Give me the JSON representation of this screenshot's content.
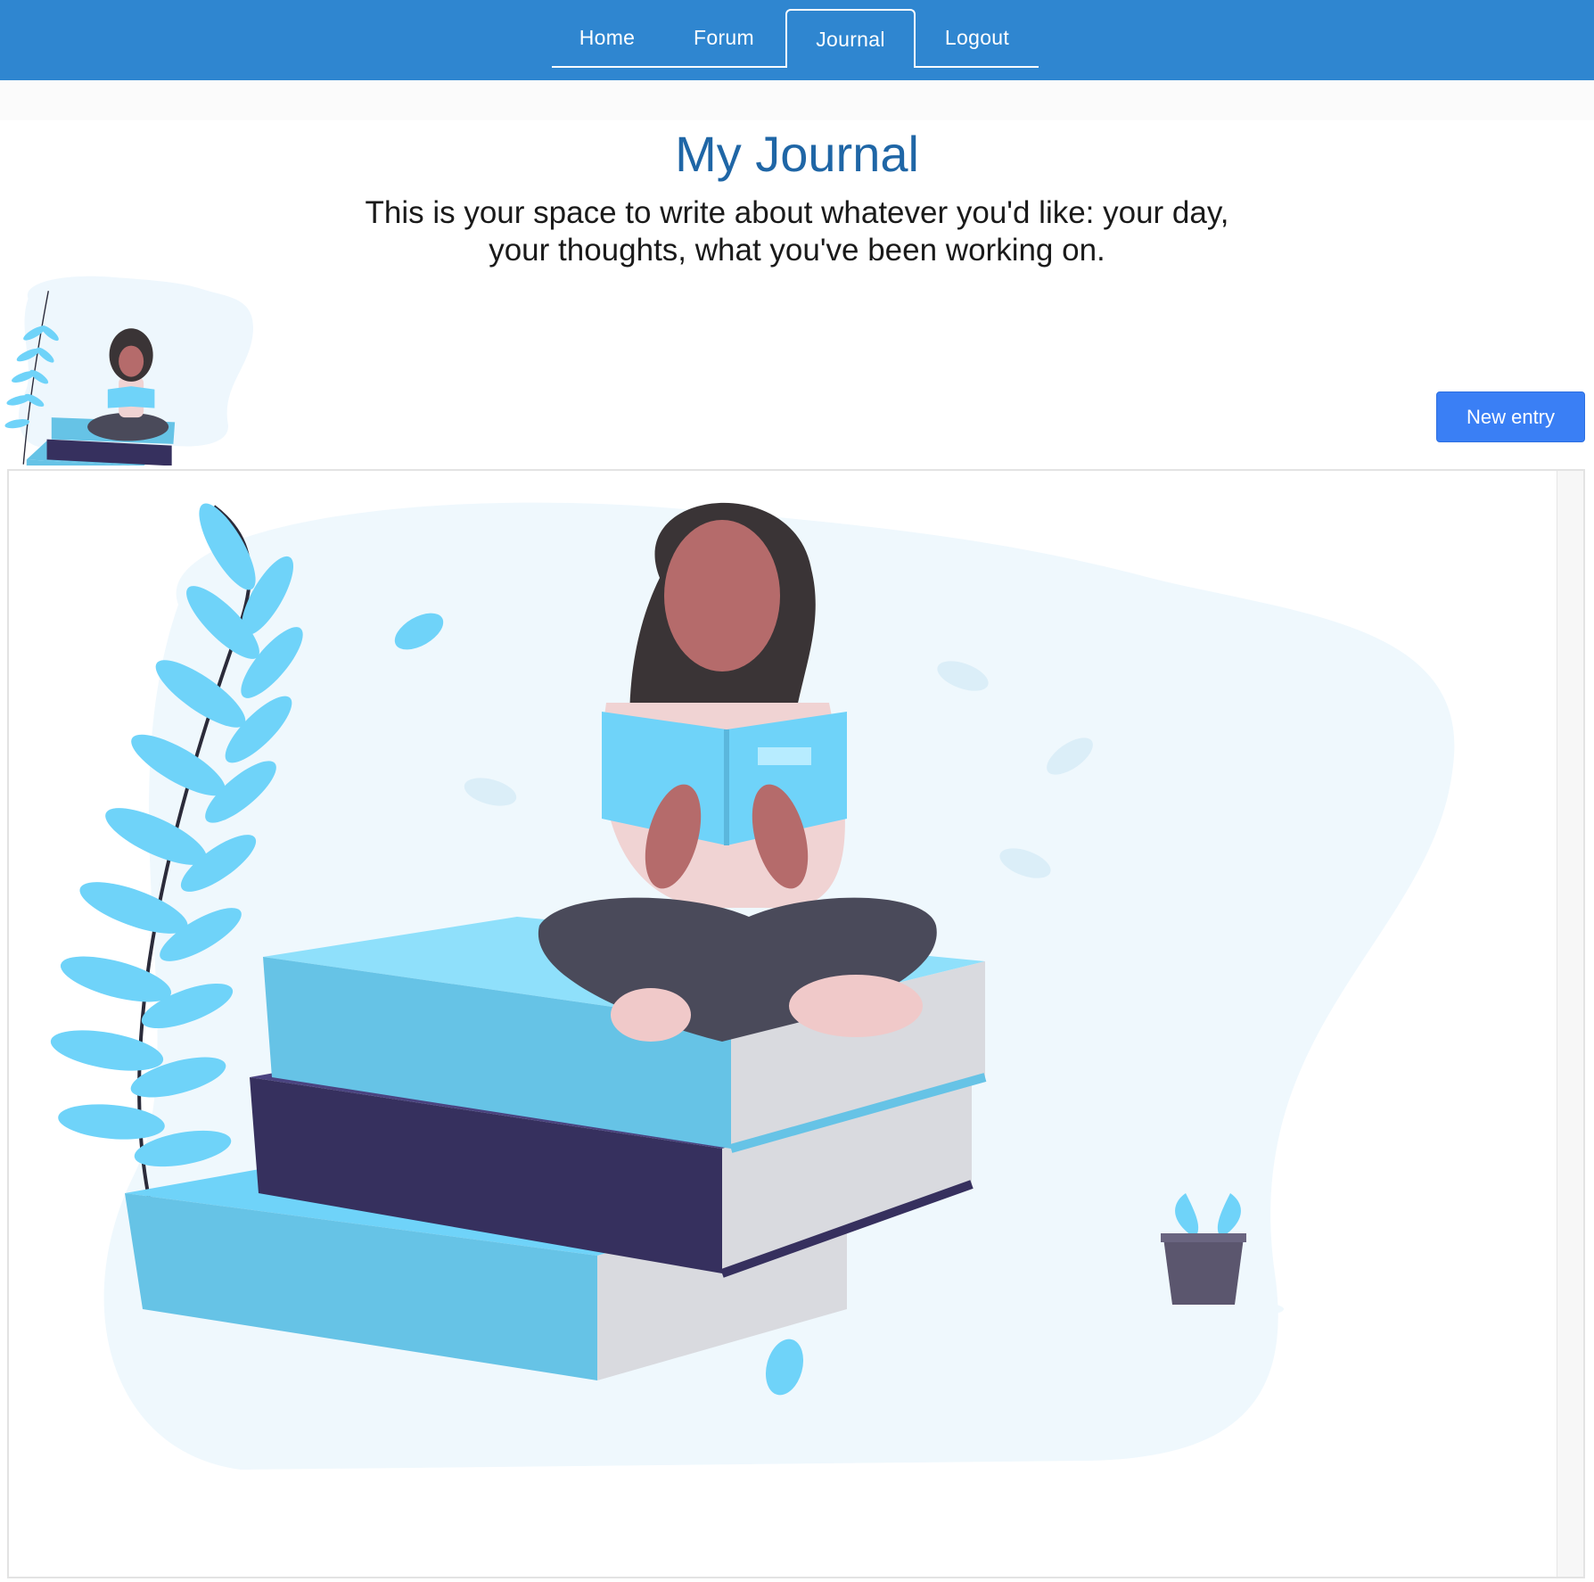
{
  "nav": {
    "tabs": [
      {
        "label": "Home",
        "active": false
      },
      {
        "label": "Forum",
        "active": false
      },
      {
        "label": "Journal",
        "active": true
      },
      {
        "label": "Logout",
        "active": false
      }
    ]
  },
  "page": {
    "title": "My Journal",
    "subtitle_line1": "This is your space to write about whatever you'd like: your day,",
    "subtitle_line2": "your thoughts, what you've been working on."
  },
  "actions": {
    "new_entry_label": "New entry"
  },
  "illustration": {
    "subject": "person reading on stack of books",
    "icon_names": [
      "fern-leaf-icon",
      "potted-plant-icon",
      "leaf-icon"
    ]
  },
  "colors": {
    "navbar": "#2f86d0",
    "title": "#1f66a6",
    "button": "#3a7ff5",
    "book_light": "#66c3e6",
    "book_dark": "#36305e",
    "plant": "#6fd3f9"
  }
}
